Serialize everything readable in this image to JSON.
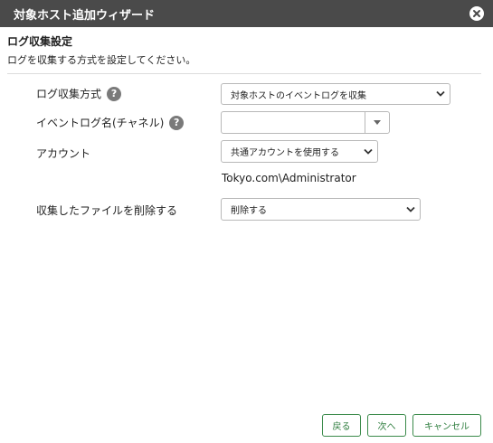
{
  "window": {
    "title": "対象ホスト追加ウィザード"
  },
  "section": {
    "title": "ログ収集設定",
    "description": "ログを収集する方式を設定してください。"
  },
  "form": {
    "method": {
      "label": "ログ収集方式",
      "value": "対象ホストのイベントログを収集"
    },
    "event_log_name": {
      "label": "イベントログ名(チャネル)",
      "value": ""
    },
    "account": {
      "label": "アカウント",
      "value": "共通アカウントを使用する",
      "account_name": "Tokyo.com\\Administrator"
    },
    "delete_files": {
      "label": "収集したファイルを削除する",
      "value": "削除する"
    }
  },
  "buttons": {
    "back": "戻る",
    "next": "次へ",
    "cancel": "キャンセル"
  },
  "icons": {
    "help": "?",
    "close": "close-icon",
    "dropdown": "chevron-down-icon"
  },
  "colors": {
    "titlebar": "#4a4a4a",
    "button_accent": "#2e7d3e",
    "help_icon": "#7a7a7a"
  }
}
